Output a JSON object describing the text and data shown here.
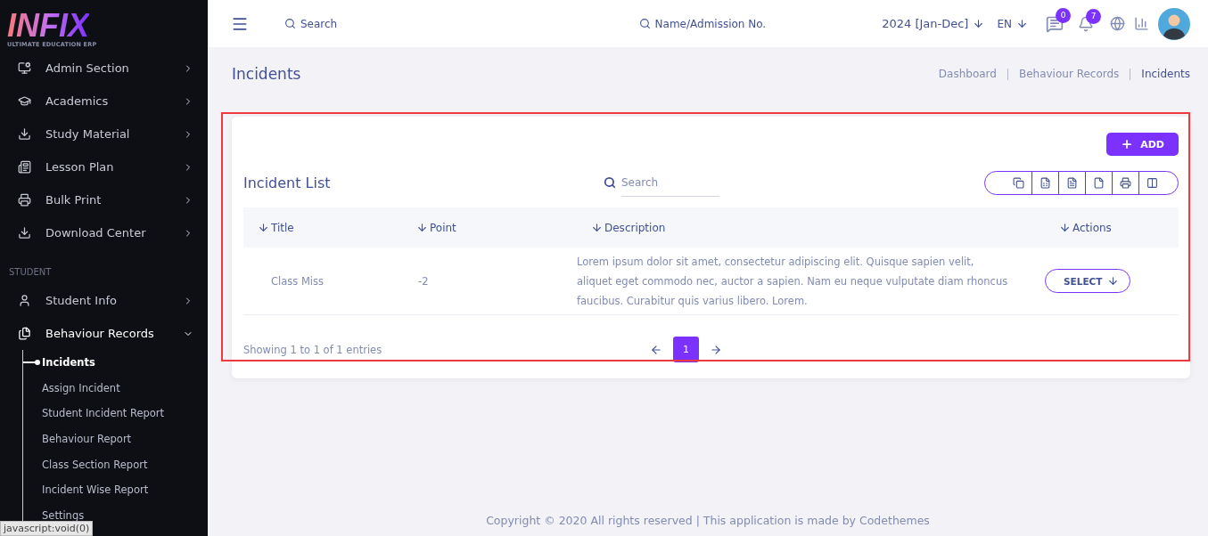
{
  "logo": {
    "name": "INFIX",
    "tagline": "ULTIMATE EDUCATION ERP"
  },
  "sidebar": {
    "groups": [
      {
        "items": [
          {
            "label": "Admin Section",
            "kind": "admin",
            "expanded": false
          },
          {
            "label": "Academics",
            "kind": "academics",
            "expanded": false
          },
          {
            "label": "Study Material",
            "kind": "download",
            "expanded": false
          },
          {
            "label": "Lesson Plan",
            "kind": "plan",
            "expanded": false
          },
          {
            "label": "Bulk Print",
            "kind": "print",
            "expanded": false
          },
          {
            "label": "Download Center",
            "kind": "download",
            "expanded": false
          }
        ]
      },
      {
        "heading": "STUDENT",
        "items": [
          {
            "label": "Student Info",
            "kind": "student",
            "expanded": false
          },
          {
            "label": "Behaviour Records",
            "kind": "records",
            "expanded": true,
            "children": [
              {
                "label": "Incidents",
                "selected": true
              },
              {
                "label": "Assign Incident",
                "selected": false
              },
              {
                "label": "Student Incident Report",
                "selected": false
              },
              {
                "label": "Behaviour Report",
                "selected": false
              },
              {
                "label": "Class Section Report",
                "selected": false
              },
              {
                "label": "Incident Wise Report",
                "selected": false
              },
              {
                "label": "Settings",
                "selected": false
              }
            ]
          }
        ]
      }
    ]
  },
  "header": {
    "search": "Search",
    "student_search": "Name/Admission No.",
    "session": "2024 [Jan-Dec]",
    "language": "EN",
    "messages_count": "0",
    "notifications_count": "7"
  },
  "page": {
    "title": "Incidents",
    "breadcrumbs": [
      "Dashboard",
      "Behaviour Records",
      "Incidents"
    ]
  },
  "card": {
    "add_button": "ADD",
    "title": "Incident List",
    "search": {
      "placeholder": "Search"
    },
    "columns": [
      "Title",
      "Point",
      "Description",
      "Actions"
    ],
    "rows": [
      {
        "title": "Class Miss",
        "point": "-2",
        "description": "Lorem ipsum dolor sit amet, consectetur adipiscing elit. Quisque sapien velit, aliquet eget commodo nec, auctor a sapien. Nam eu neque vulputate diam rhoncus faucibus. Curabitur quis varius libero. Lorem.",
        "action": "SELECT"
      }
    ],
    "entries": "Showing 1 to 1 of 1 entries",
    "pages": [
      {
        "label": "1",
        "selected": true
      }
    ]
  },
  "footer": "Copyright © 2020 All rights reserved | This application is made by Codethemes",
  "status_bar": "javascript:void(0)"
}
